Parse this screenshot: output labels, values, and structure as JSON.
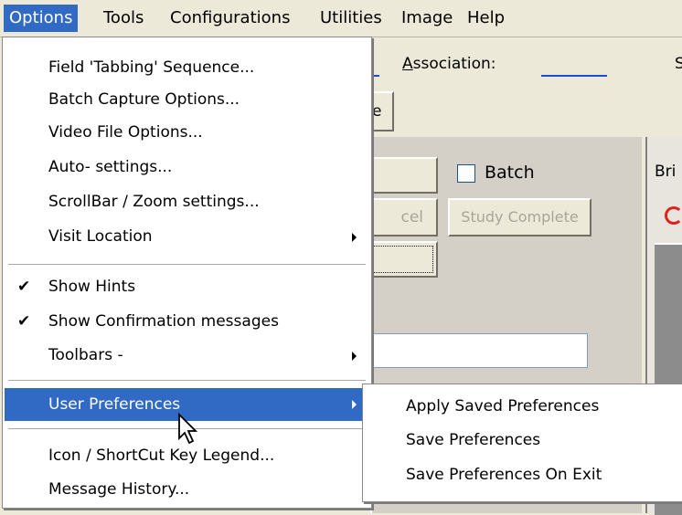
{
  "menubar": {
    "items": [
      "Options",
      "Tools",
      "Configurations",
      "Utilities",
      "Image",
      "Help"
    ],
    "active": "Options"
  },
  "background": {
    "association_label": "Association:",
    "s_label": "S",
    "e_button_label": "e",
    "batch_label": "Batch",
    "cancel_partial": "cel",
    "study_complete_label": "Study Complete",
    "bri_label": "Bri"
  },
  "options_menu": {
    "items": [
      {
        "label": "Field 'Tabbing' Sequence..."
      },
      {
        "label": "Batch Capture Options..."
      },
      {
        "label": "Video File Options..."
      },
      {
        "label": "Auto- settings..."
      },
      {
        "label": "ScrollBar / Zoom settings..."
      },
      {
        "label": "Visit Location",
        "submenu": true
      },
      {
        "label": "Show Hints",
        "checked": true
      },
      {
        "label": "Show Confirmation messages",
        "checked": true
      },
      {
        "label": "Toolbars -",
        "submenu": true
      },
      {
        "label": "User Preferences",
        "submenu": true,
        "highlighted": true
      },
      {
        "label": "Icon / ShortCut Key Legend..."
      },
      {
        "label": "Message History..."
      }
    ]
  },
  "user_preferences_submenu": {
    "items": [
      "Apply Saved Preferences",
      "Save Preferences",
      "Save Preferences On Exit"
    ]
  },
  "icons": {
    "check": "check-icon",
    "submenu_arrow": "chevron-right-icon",
    "cursor": "mouse-pointer-icon",
    "spinner": "refresh-icon"
  },
  "colors": {
    "highlight": "#316ac5",
    "menubar_bg": "#ece9d8",
    "menu_bg": "#ffffff"
  }
}
